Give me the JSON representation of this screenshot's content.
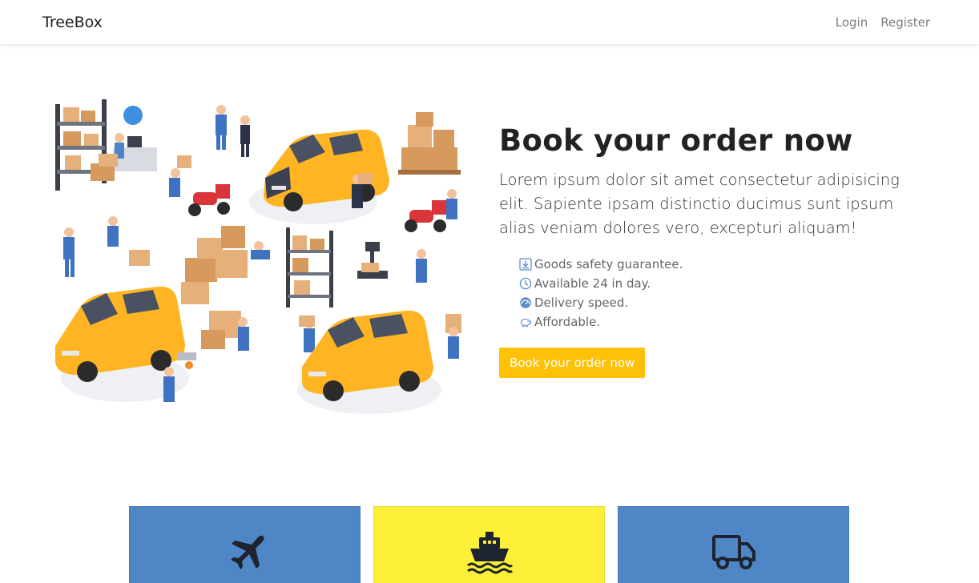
{
  "navbar": {
    "brand": "TreeBox",
    "links": [
      "Login",
      "Register"
    ]
  },
  "hero": {
    "title": "Book your order now",
    "lead": "Lorem ipsum dolor sit amet consectetur adipisicing elit. Sapiente ipsam distinctio ducimus sunt ipsum alias veniam dolores vero, excepturi aliquam!",
    "features": [
      {
        "icon": "download-box-icon",
        "label": "Goods safety guarantee."
      },
      {
        "icon": "clock-icon",
        "label": "Available 24 in day."
      },
      {
        "icon": "speedometer-icon",
        "label": "Delivery speed."
      },
      {
        "icon": "piggy-bank-icon",
        "label": "Affordable."
      }
    ],
    "cta_label": "Book your order now",
    "illustration": "delivery-logistics-illustration"
  },
  "services": [
    {
      "icon": "airplane-icon",
      "color": "#4f86c6"
    },
    {
      "icon": "ship-icon",
      "color": "#fbef37"
    },
    {
      "icon": "truck-icon",
      "color": "#4f86c6"
    }
  ],
  "colors": {
    "accent": "#ffc107",
    "card_blue": "#4f86c6",
    "card_yellow": "#fbef37",
    "feature_icon": "#5a8bd0"
  }
}
